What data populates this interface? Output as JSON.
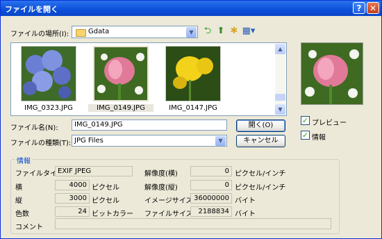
{
  "window": {
    "title": "ファイルを開く",
    "help": "?",
    "close": "✕"
  },
  "location": {
    "label": "ファイルの場所(I):",
    "value": "Gdata"
  },
  "files": [
    {
      "name": "IMG_0323.JPG",
      "selected": false
    },
    {
      "name": "IMG_0149.JPG",
      "selected": true
    },
    {
      "name": "IMG_0147.JPG",
      "selected": false
    }
  ],
  "filename": {
    "label": "ファイル名(N):",
    "value": "IMG_0149.JPG"
  },
  "filetype": {
    "label": "ファイルの種類(T):",
    "value": "JPG Files"
  },
  "buttons": {
    "open": "開く(O)",
    "cancel": "キャンセル"
  },
  "options": {
    "preview": "プレビュー",
    "info": "情報"
  },
  "info": {
    "group_label": "情報",
    "file_type_label": "ファイルタイプ",
    "file_type": "EXIF JPEG",
    "width_label": "横",
    "width": "4000",
    "width_unit": "ピクセル",
    "height_label": "縦",
    "height": "3000",
    "height_unit": "ピクセル",
    "colors_label": "色数",
    "colors": "24",
    "colors_unit": "ビットカラー",
    "res_h_label": "解像度(横)",
    "res_h": "0",
    "res_h_unit": "ピクセル/インチ",
    "res_v_label": "解像度(縦)",
    "res_v": "0",
    "res_v_unit": "ピクセル/インチ",
    "image_size_label": "イメージサイズ",
    "image_size": "36000000",
    "image_size_unit": "バイト",
    "file_size_label": "ファイルサイズ",
    "file_size": "2188834",
    "file_size_unit": "バイト",
    "comment_label": "コメント",
    "comment": ""
  }
}
